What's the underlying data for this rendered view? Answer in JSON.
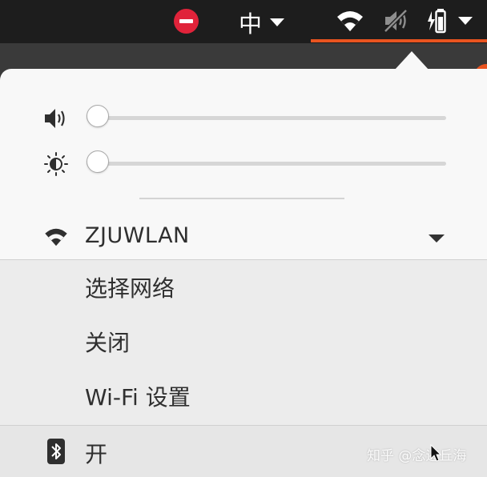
{
  "top_panel": {
    "input_method_label": "中",
    "icons": {
      "do_not_disturb": "do-not-disturb-icon",
      "input_method_dropdown": "chevron-down-icon",
      "wifi": "wifi-icon",
      "audio": "speaker-muted-icon",
      "battery": "battery-charging-icon",
      "system_menu_dropdown": "chevron-down-icon"
    }
  },
  "menu": {
    "volume": {
      "icon": "speaker-icon",
      "level": 0
    },
    "brightness": {
      "icon": "brightness-icon",
      "level": 0
    },
    "wifi": {
      "icon": "wifi-icon",
      "network_name": "ZJUWLAN",
      "submenu": [
        {
          "label": "选择网络"
        },
        {
          "label": "关闭"
        },
        {
          "label": "Wi-Fi 设置"
        }
      ]
    },
    "bluetooth": {
      "icon": "bluetooth-icon",
      "label": "开"
    }
  },
  "watermark": "知乎 @念迹丘海",
  "colors": {
    "accent": "#e95420",
    "panel_bg": "#1d1d1d",
    "menu_bg": "#f8f8f8",
    "submenu_bg": "#ececec",
    "dnd_red": "#e0233a"
  }
}
